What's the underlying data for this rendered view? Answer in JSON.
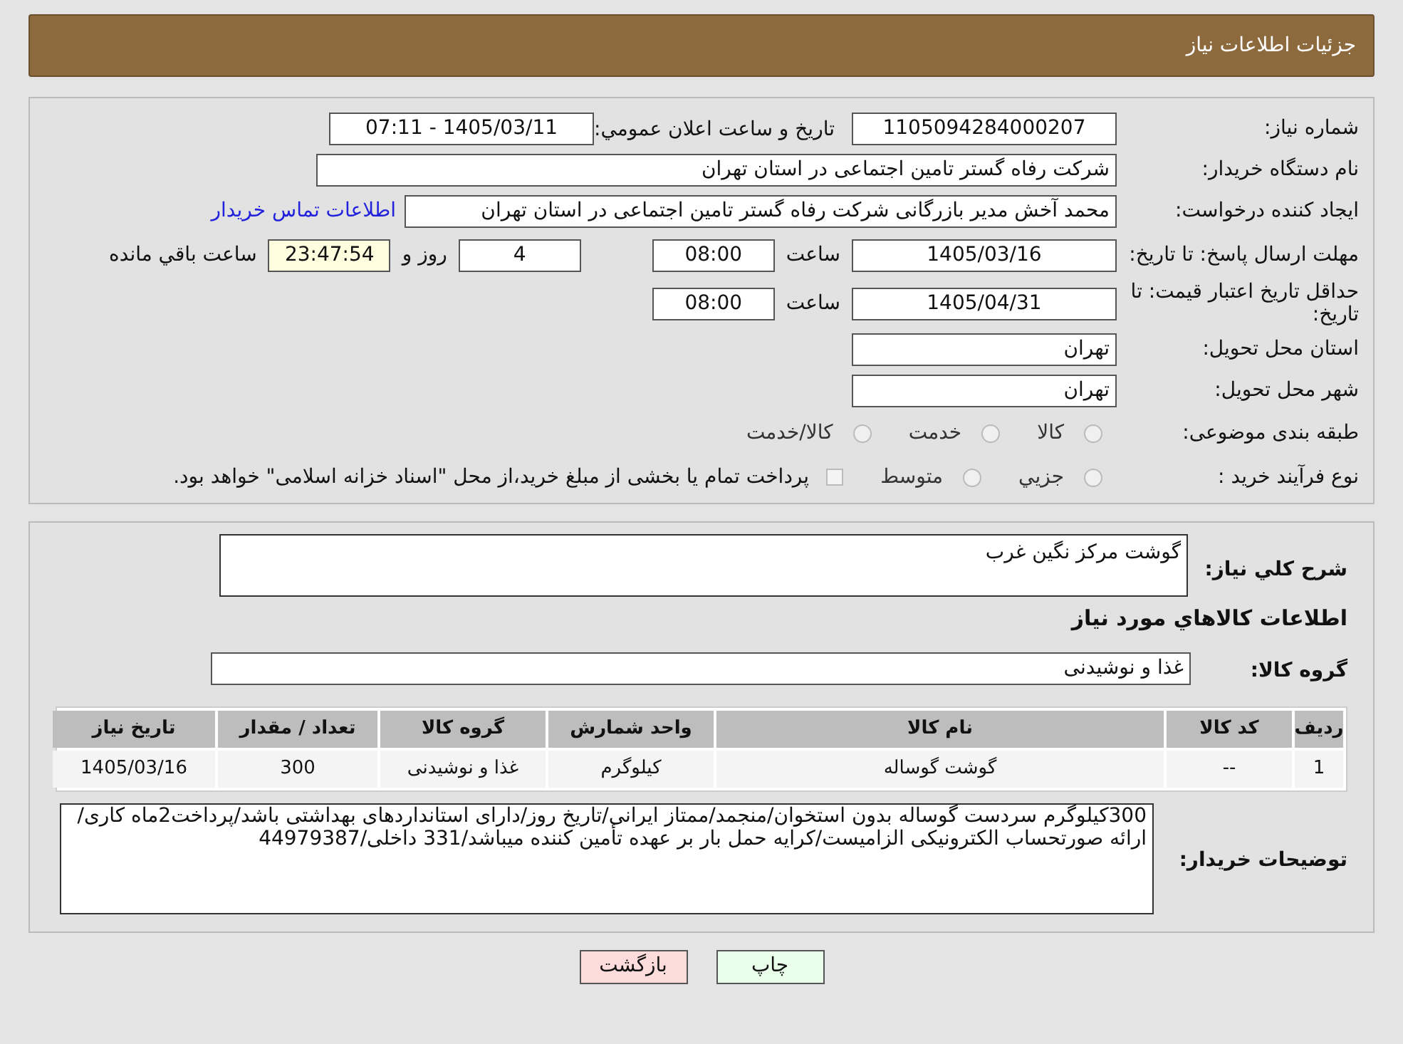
{
  "header": {
    "title": "جزئیات اطلاعات نیاز"
  },
  "need_number": {
    "label": "شماره نیاز:",
    "value": "1105094284000207"
  },
  "announce": {
    "label": "تاریخ و ساعت اعلان عمومي:",
    "value": "1405/03/11 - 07:11"
  },
  "buyer_org": {
    "label": "نام دستگاه خریدار:",
    "value": "شرکت رفاه گستر تامین اجتماعی در استان تهران"
  },
  "requester": {
    "label": "ایجاد کننده درخواست:",
    "value": "محمد آخش مدیر بازرگانی شرکت رفاه گستر تامین اجتماعی در استان تهران",
    "link": "اطلاعات تماس خریدار"
  },
  "deadline": {
    "label": "مهلت ارسال پاسخ: تا تاریخ:",
    "date": "1405/03/16",
    "time_label": "ساعت",
    "time": "08:00",
    "days": "4",
    "days_label": "روز و",
    "remaining": "23:47:54",
    "remaining_label": "ساعت باقي مانده"
  },
  "validity": {
    "label": "حداقل تاریخ اعتبار قیمت: تا تاریخ:",
    "date": "1405/04/31",
    "time_label": "ساعت",
    "time": "08:00"
  },
  "province": {
    "label": "استان محل تحویل:",
    "value": "تهران"
  },
  "city": {
    "label": "شهر محل تحویل:",
    "value": "تهران"
  },
  "category": {
    "label": "طبقه بندی موضوعی:",
    "options": [
      {
        "label": "کالا",
        "selected": false
      },
      {
        "label": "خدمت",
        "selected": false
      },
      {
        "label": "کالا/خدمت",
        "selected": false
      }
    ]
  },
  "process": {
    "label": "نوع فرآیند خرید :",
    "options": [
      {
        "label": "جزيي",
        "selected": false
      },
      {
        "label": "متوسط",
        "selected": false
      }
    ],
    "payment": {
      "checked": false,
      "text": "پرداخت تمام یا بخشی از مبلغ خرید،از محل \"اسناد خزانه اسلامی\" خواهد بود."
    }
  },
  "description": {
    "label": "شرح کلي نیاز:",
    "value": "گوشت مرکز نگین غرب"
  },
  "goods_heading": "اطلاعات کالاهاي مورد نیاز",
  "goods_group": {
    "label": "گروه کالا:",
    "value": "غذا و نوشیدنی"
  },
  "table": {
    "columns": [
      "ردیف",
      "کد کالا",
      "نام کالا",
      "واحد شمارش",
      "گروه کالا",
      "تعداد / مقدار",
      "تاریخ نیاز"
    ],
    "rows": [
      [
        "1",
        "--",
        "گوشت گوساله",
        "کیلوگرم",
        "غذا و نوشیدنی",
        "300",
        "1405/03/16"
      ]
    ]
  },
  "buyer_notes": {
    "label": "توضیحات خریدار:",
    "value": "300کیلوگرم سردست گوساله بدون استخوان/منجمد/ممتاز ایرانی/تاریخ روز/دارای استانداردهای بهداشتی باشد/پرداخت2ماه کاری/ارائه صورتحساب الکترونیکی الزامیست/کرایه حمل بار بر عهده تأمین کننده میباشد/331 داخلی/44979387"
  },
  "buttons": [
    {
      "kind": "print",
      "label": "چاپ"
    },
    {
      "kind": "back",
      "label": "بازگشت"
    }
  ]
}
